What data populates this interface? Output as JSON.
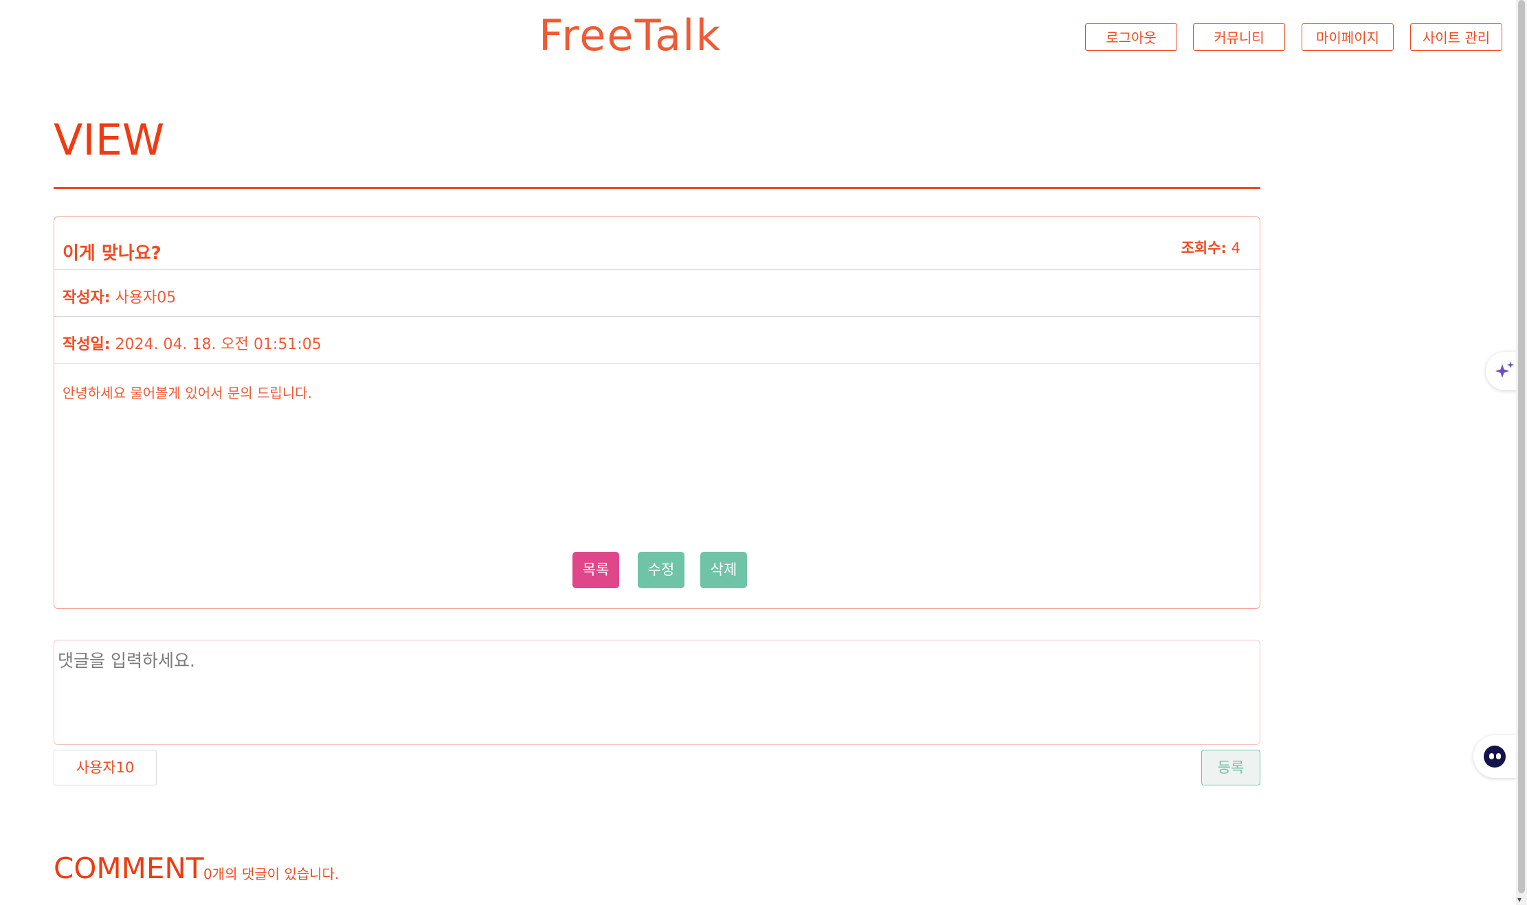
{
  "header": {
    "logo": "FreeTalk",
    "nav": [
      {
        "label": "로그아웃"
      },
      {
        "label": "커뮤니티"
      },
      {
        "label": "마이페이지"
      },
      {
        "label": "사이트 관리"
      }
    ]
  },
  "page": {
    "title": "VIEW"
  },
  "post": {
    "title": "이게 맞나요?",
    "views_label": "조회수:",
    "views": "4",
    "author_label": "작성자:",
    "author": "사용자05",
    "date_label": "작성일:",
    "date": "2024. 04. 18. 오전 01:51:05",
    "body": "안녕하세요 물어볼게 있어서 문의 드립니다."
  },
  "actions": {
    "list": "목록",
    "edit": "수정",
    "delete": "삭제"
  },
  "comment_form": {
    "placeholder": "댓글을 입력하세요.",
    "user": "사용자10",
    "submit": "등록"
  },
  "comments": {
    "heading": "COMMENT",
    "count_text": "0개의 댓글이 있습니다."
  },
  "colors": {
    "accent": "#f04a22",
    "list_button": "#e0478b",
    "edit_button": "#6fc3a6"
  },
  "widgets": {
    "sparkle": "sparkle-icon",
    "bot": "chatbot-icon"
  }
}
